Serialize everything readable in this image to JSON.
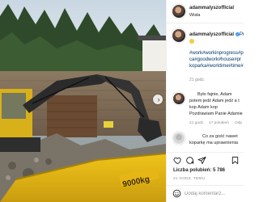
{
  "post": {
    "photo": {
      "icon": "photo-excavator-construction",
      "next_icon": "chevron-right-icon",
      "next_glyph": "›",
      "bucket_text": "9000kg"
    },
    "author": {
      "username": "adammalyszofficial",
      "location": "Wisła",
      "verified_glyph": "✓",
      "more_glyph": "•••"
    },
    "caption": {
      "username": "adammalyszofficial",
      "lines": [
        "Pr",
        "#work#workinprogress#p",
        "ca#goodwork#house#pr",
        "koparka#worktime#time#"
      ],
      "time": "21 godz."
    },
    "comments": [
      {
        "lines": [
          "Było fajnie, Adam",
          "potem jedź Adam jedź a t",
          "kop Adam kop",
          "Pozdrawiam Panie Adamie"
        ],
        "time": "21 godz.",
        "likes": "17 polubień",
        "reply": "Odp"
      },
      {
        "lines": [
          "Co za gość nawet",
          "koparkę ma uprawnienia"
        ],
        "time": "21 godz."
      }
    ],
    "likes_text": "Liczba polubień: 5 786",
    "date": "21 GODZ. TEMU",
    "comment_placeholder": "Dodaj komentarz..."
  },
  "colors": {
    "hashtag": "#00376b",
    "verified": "#3897f0",
    "muted": "#8e8e8e",
    "border": "#efefef"
  },
  "icons": [
    "heart-icon",
    "comment-icon",
    "share-icon",
    "bookmark-icon",
    "smile-icon",
    "verified-icon",
    "more-icon"
  ]
}
